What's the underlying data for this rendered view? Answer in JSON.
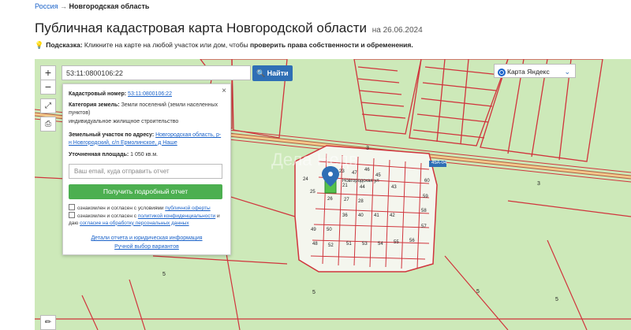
{
  "breadcrumb": {
    "root": "Россия",
    "sep": "→",
    "current": "Новгородская область"
  },
  "title": "Публичная кадастровая карта Новгородской области",
  "title_date": "на 26.06.2024",
  "hint": {
    "label": "Подсказка:",
    "text": "Кликните на карте на любой участок или дом, чтобы",
    "bold": "проверить права собственности и обременения."
  },
  "map": {
    "zoom_in": "+",
    "zoom_out": "−",
    "search_value": "53:11:0800106:22",
    "search_button": "Найти",
    "layer_select": "Карта Яндекс",
    "popup": {
      "close": "×",
      "cadnum_label": "Кадастровый номер:",
      "cadnum_value": "53:11:0800106:22",
      "category_label": "Категория земель:",
      "category_value": "Земли поселений (земли населенных пунктов)",
      "usage": "индивидуальное жилищное строительство",
      "address_label": "Земельный участок по адресу:",
      "address_value": "Новгородская область, р-н Новгородский, с/п Ермолинское, д Наше",
      "area_label": "Уточненная площадь:",
      "area_value": "1 050 кв.м.",
      "email_placeholder": "Ваш email, куда отправить отчет",
      "get_button": "Получить подробный отчет",
      "agree1_text": "ознакомлен и согласен с условиями",
      "agree1_link": "публичной оферты",
      "agree2_text": "ознакомлен и согласен с",
      "agree2_link": "политикой конфиденциальности",
      "agree2_text2": "и даю",
      "agree2_link2": "согласие на обработку персональных данных",
      "details_link": "Детали отчета и юридическая информация",
      "manual_link": "Ручной выбор вариантов"
    },
    "road_labels": [
      "3",
      "3",
      "5",
      "5",
      "5",
      "5"
    ],
    "highway_badge": "45А-04",
    "street_label": "Новгородская ул",
    "plot_numbers": [
      "24",
      "25",
      "26",
      "21",
      "23",
      "46",
      "47",
      "36",
      "27",
      "28",
      "45",
      "44",
      "43",
      "42",
      "41",
      "40",
      "58",
      "59",
      "60",
      "57",
      "56",
      "55",
      "54",
      "53",
      "51",
      "52",
      "48",
      "49",
      "50"
    ],
    "watermark": "Дела Недв"
  },
  "colors": {
    "map_bg": "#cde9b9",
    "plot_line": "#d0343c",
    "selected_plot": "#55c24b",
    "accent": "#2f6fb5"
  }
}
